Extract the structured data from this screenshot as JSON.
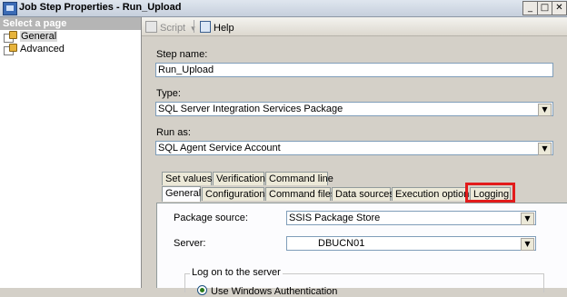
{
  "window": {
    "title": "Job Step Properties - Run_Upload",
    "controls": {
      "minimize": "_",
      "maximize": "□",
      "close": "✕"
    }
  },
  "left_panel": {
    "header": "Select a page",
    "pages": [
      {
        "label": "General",
        "selected": true,
        "icon": "page-icon"
      },
      {
        "label": "Advanced",
        "selected": false,
        "icon": "page-icon"
      }
    ]
  },
  "toolbar": {
    "script_label": "Script",
    "script_dropdown": "▾",
    "help_label": "Help"
  },
  "form": {
    "step_name_label": "Step name:",
    "step_name_value": "Run_Upload",
    "type_label": "Type:",
    "type_value": "SQL Server Integration Services Package",
    "run_as_label": "Run as:",
    "run_as_value": "SQL Agent Service Account"
  },
  "tabs": {
    "row1": [
      "Set values",
      "Verification",
      "Command line"
    ],
    "row2": [
      "General",
      "Configurations",
      "Command files",
      "Data sources",
      "Execution options",
      "Logging"
    ],
    "active": "General",
    "highlighted": "Logging"
  },
  "general_tab": {
    "package_source_label": "Package source:",
    "package_source_value": "SSIS Package Store",
    "server_label": "Server:",
    "server_value": "DBUCN01",
    "logon_group_title": "Log on to the server",
    "windows_auth_label": "Use Windows Authentication"
  },
  "colors": {
    "highlight_box": "#e21b1b",
    "window_bg": "#d4d0c8",
    "field_border": "#7f9db9"
  }
}
